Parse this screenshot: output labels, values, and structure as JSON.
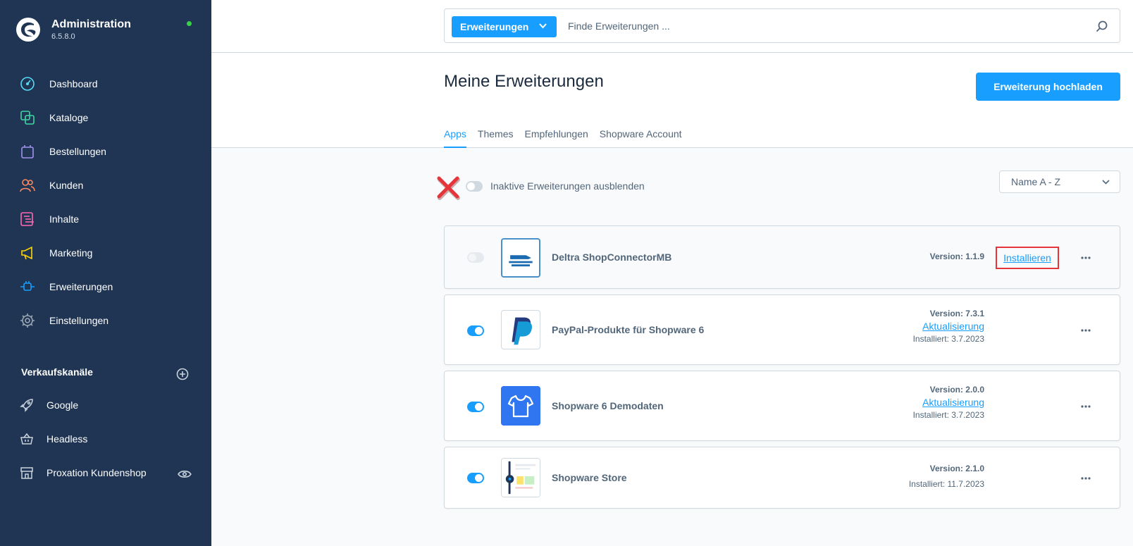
{
  "app": {
    "title": "Administration",
    "version": "6.5.8.0"
  },
  "nav": [
    {
      "label": "Dashboard",
      "icon": "dashboard-icon",
      "color": "#57d9f6"
    },
    {
      "label": "Kataloge",
      "icon": "catalog-icon",
      "color": "#3ed6a4"
    },
    {
      "label": "Bestellungen",
      "icon": "orders-icon",
      "color": "#a092f0"
    },
    {
      "label": "Kunden",
      "icon": "customers-icon",
      "color": "#f88962"
    },
    {
      "label": "Inhalte",
      "icon": "content-icon",
      "color": "#ff68b4"
    },
    {
      "label": "Marketing",
      "icon": "marketing-icon",
      "color": "#ffd700"
    },
    {
      "label": "Erweiterungen",
      "icon": "extensions-icon",
      "color": "#189eff"
    },
    {
      "label": "Einstellungen",
      "icon": "settings-icon",
      "color": "#9aa8b5"
    }
  ],
  "sales_channels": {
    "title": "Verkaufskanäle",
    "items": [
      {
        "label": "Google",
        "icon": "rocket-icon"
      },
      {
        "label": "Headless",
        "icon": "basket-icon"
      },
      {
        "label": "Proxation Kundenshop",
        "icon": "storefront-icon"
      }
    ]
  },
  "search": {
    "type_label": "Erweiterungen",
    "placeholder": "Finde Erweiterungen ..."
  },
  "page": {
    "title": "Meine Erweiterungen",
    "upload_label": "Erweiterung hochladen",
    "tabs": [
      "Apps",
      "Themes",
      "Empfehlungen",
      "Shopware Account"
    ]
  },
  "filter": {
    "hide_inactive_label": "Inaktive Erweiterungen ausblenden",
    "sort_value": "Name A - Z"
  },
  "extensions": [
    {
      "name": "Deltra ShopConnectorMB",
      "version": "Version: 1.1.9",
      "action": "Installieren",
      "active": false
    },
    {
      "name": "PayPal-Produkte für Shopware 6",
      "version": "Version: 7.3.1",
      "action": "Aktualisierung",
      "installed": "Installiert: 3.7.2023",
      "active": true
    },
    {
      "name": "Shopware 6 Demodaten",
      "version": "Version: 2.0.0",
      "action": "Aktualisierung",
      "installed": "Installiert: 3.7.2023",
      "active": true
    },
    {
      "name": "Shopware Store",
      "version": "Version: 2.1.0",
      "installed": "Installiert: 11.7.2023",
      "active": true
    }
  ],
  "colors": {
    "sidebar": "#1f3553",
    "accent": "#189eff",
    "status_online": "#37d046",
    "highlight": "#e5353b"
  }
}
